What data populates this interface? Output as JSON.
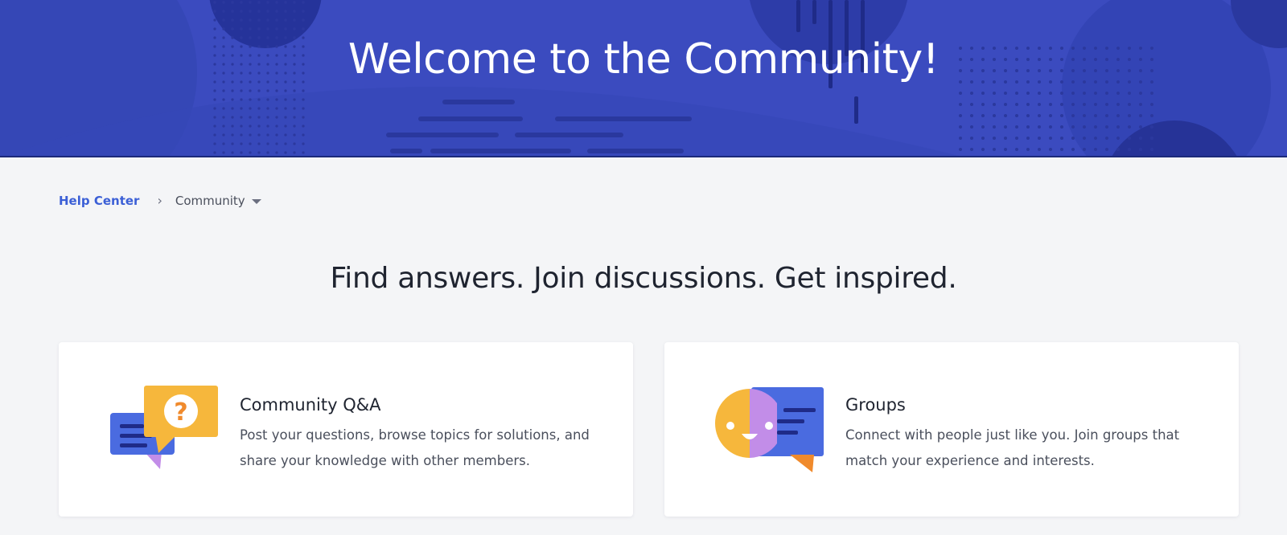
{
  "hero": {
    "title": "Welcome to the Community!"
  },
  "breadcrumb": {
    "home_label": "Help Center",
    "separator": "›",
    "current_label": "Community"
  },
  "tagline": "Find answers. Join discussions. Get inspired.",
  "cards": [
    {
      "title": "Community Q&A",
      "description": "Post your questions, browse topics for solutions, and share your knowledge with other members.",
      "icon": "question-speech-bubbles-icon"
    },
    {
      "title": "Groups",
      "description": "Connect with people just like you. Join groups that match your experience and interests.",
      "icon": "smiley-chat-bubble-icon"
    }
  ],
  "colors": {
    "hero_bg": "#3b4bbf",
    "link": "#3b5fd6",
    "page_bg": "#f4f5f7",
    "accent_yellow": "#f6b73c",
    "accent_blue": "#4a6be0",
    "accent_purple": "#c28de8",
    "accent_orange": "#f08a2c"
  }
}
